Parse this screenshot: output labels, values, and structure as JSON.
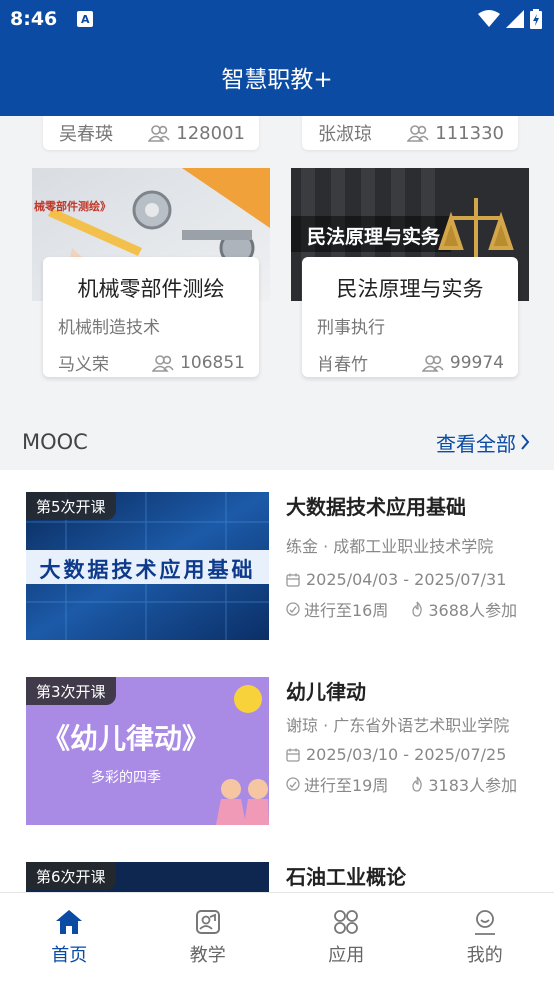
{
  "status_bar": {
    "time": "8:46"
  },
  "header": {
    "title": "智慧职教+"
  },
  "top_cards": [
    {
      "teacher": "吴春瑛",
      "count": "128001"
    },
    {
      "teacher": "张淑琼",
      "count": "111330"
    }
  ],
  "courses": [
    {
      "name": "机械零部件测绘",
      "major": "机械制造技术",
      "teacher": "马义荣",
      "count": "106851",
      "thumb_text": "械零部件测绘》"
    },
    {
      "name": "民法原理与实务",
      "major": "刑事执行",
      "teacher": "肖春竹",
      "count": "99974",
      "thumb_text": "民法原理与实务"
    }
  ],
  "mooc": {
    "title": "MOOC",
    "see_all": "查看全部",
    "items": [
      {
        "badge": "第5次开课",
        "title": "大数据技术应用基础",
        "school": "练金 · 成都工业职业技术学院",
        "dates": "2025/04/03 - 2025/07/31",
        "progress": "进行至16周",
        "participants": "3688人参加",
        "thumb_text": "大数据技术应用基础"
      },
      {
        "badge": "第3次开课",
        "title": "幼儿律动",
        "school": "谢琼 · 广东省外语艺术职业学院",
        "dates": "2025/03/10 - 2025/07/25",
        "progress": "进行至19周",
        "participants": "3183人参加",
        "thumb_text": "《幼儿律动》",
        "thumb_sub": "多彩的四季"
      },
      {
        "badge": "第6次开课",
        "title": "石油工业概论"
      }
    ]
  },
  "tabs": [
    {
      "label": "首页",
      "icon": "home-icon",
      "active": true
    },
    {
      "label": "教学",
      "icon": "teach-icon",
      "active": false
    },
    {
      "label": "应用",
      "icon": "apps-icon",
      "active": false
    },
    {
      "label": "我的",
      "icon": "profile-icon",
      "active": false
    }
  ],
  "colors": {
    "brand": "#0b4ba4",
    "background": "#f2f3f5"
  }
}
